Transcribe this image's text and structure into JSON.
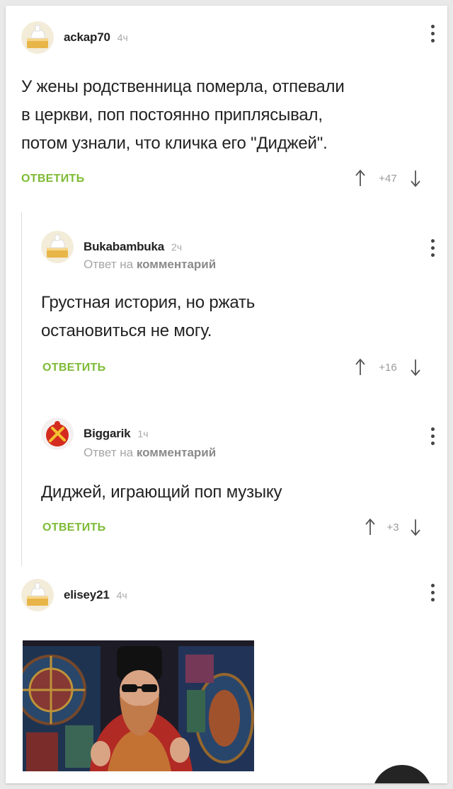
{
  "comments": [
    {
      "username": "аckap70",
      "time": "4ч",
      "text_lines": [
        "У жены родственница померла, отпевали",
        "в церкви, поп постоянно приплясывал,",
        "потом узнали, что кличка его \"Диджей\"."
      ],
      "reply_label": "ОТВЕТИТЬ",
      "votes": "+47",
      "avatar": "default-cake-avatar"
    },
    {
      "username": "Bukabambuka",
      "time": "2ч",
      "reply_to_prefix": "Ответ на",
      "reply_to_link": "комментарий",
      "text_lines": [
        "Грустная история, но ржать",
        "остановиться не могу."
      ],
      "reply_label": "ОТВЕТИТЬ",
      "votes": "+16",
      "avatar": "default-cake-avatar"
    },
    {
      "username": "Biggarik",
      "time": "1ч",
      "reply_to_prefix": "Ответ на",
      "reply_to_link": "комментарий",
      "text_lines": [
        "Диджей, играющий поп музыку"
      ],
      "reply_label": "ОТВЕТИТЬ",
      "votes": "+3",
      "avatar": "red-emblem-avatar"
    },
    {
      "username": "elisey21",
      "time": "4ч",
      "avatar": "default-cake-avatar",
      "media": "priest-in-sunglasses-image"
    }
  ],
  "colors": {
    "reply": "#7dbb35",
    "username": "#222222",
    "meta": "#aaaaaa",
    "thread_line": "#dcdcdc"
  },
  "icons": {
    "upvote": "arrow-up-icon",
    "downvote": "arrow-down-icon",
    "menu": "vertical-dots-icon"
  }
}
